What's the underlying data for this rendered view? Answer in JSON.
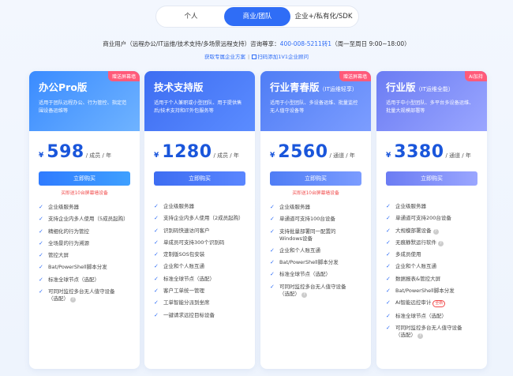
{
  "tabs": [
    "个人",
    "商业/团队",
    "企业+/私有化/SDK"
  ],
  "info": {
    "prefix": "商业用户（远程办公/IT运维/技术支持/多场景远程支持）咨询尊享：",
    "phone": "400-008-5211转1",
    "hours": "（周一至周日 9:00~18:00）"
  },
  "links": {
    "left": "获取专属企业方案",
    "right": "扫码添加1V1企业顾问"
  },
  "colors": {
    "accent": "#2f6df6",
    "promo": "#f04747",
    "badge": "#ff5a7a"
  },
  "cards": [
    {
      "title": "办公Pro版",
      "sub": "",
      "desc": "适用于团队远程办公、行为管控、指定范围设备运维等",
      "badge": "赠送屏幕墙",
      "price": "598",
      "unit": "/ 成员 / 年",
      "buy": "立即购买",
      "promo": "买即送10台屏幕墙设备",
      "features": [
        "企业级服务器",
        "支持企业内多人使用（5成员起购）",
        "精细化的行为管控",
        "全场景的行为溯源",
        "管控大屏",
        "Bat/PowerShell脚本分发",
        "标准全球节点（选配）",
        "可同时监控多台无人值守设备（选配）"
      ]
    },
    {
      "title": "技术支持版",
      "sub": "",
      "desc": "适用于个人兼职或小型团队、用于提供售后/技术支持和IT外包服务等",
      "badge": "",
      "price": "1280",
      "unit": "/ 成员 / 年",
      "buy": "立即购买",
      "promo": "",
      "features": [
        "企业级服务器",
        "支持企业内多人使用（2成员起购）",
        "识别码快速访问客户",
        "单成员可支持300个识别码",
        "定制版SOS包安装",
        "企业和个人账互通",
        "标准全球节点（选配）",
        "客户工单统一管理",
        "工单智能分派到坐席",
        "一键请求远控目标设备"
      ]
    },
    {
      "title": "行业青春版",
      "sub": "（IT运维轻享）",
      "desc": "适用于小型团队、多设备运维、批量监控无人值守设备等",
      "badge": "赠送屏幕墙",
      "price": "2560",
      "unit": "/ 通道 / 年",
      "buy": "立即购买",
      "promo": "买即送10台屏幕墙设备",
      "features": [
        "企业级服务器",
        "单通道可支持100台设备",
        "支持批量部署同一配置的Windows设备",
        "企业和个人账互通",
        "Bat/PowerShell脚本分发",
        "标准全球节点（选配）",
        "可同时监控多台无人值守设备（选配）"
      ]
    },
    {
      "title": "行业版",
      "sub": "（IT运维全能）",
      "desc": "适用于中小型团队、多平台多设备运维、批量大规模部署等",
      "badge": "AI加持",
      "price": "3380",
      "unit": "/ 通道 / 年",
      "buy": "立即购买",
      "promo": "",
      "features": [
        "企业级服务器",
        "单通道可支持200台设备",
        "大规模部署设备",
        "无痕静默运行软件",
        "多成员使用",
        "企业和个人账互通",
        "数据报表&管控大屏",
        "Bat/PowerShell脚本分发",
        "AI智能远控审计",
        "标准全球节点（选配）",
        "可同时监控多台无人值守设备（选配）"
      ],
      "new_tag": "全新"
    }
  ]
}
